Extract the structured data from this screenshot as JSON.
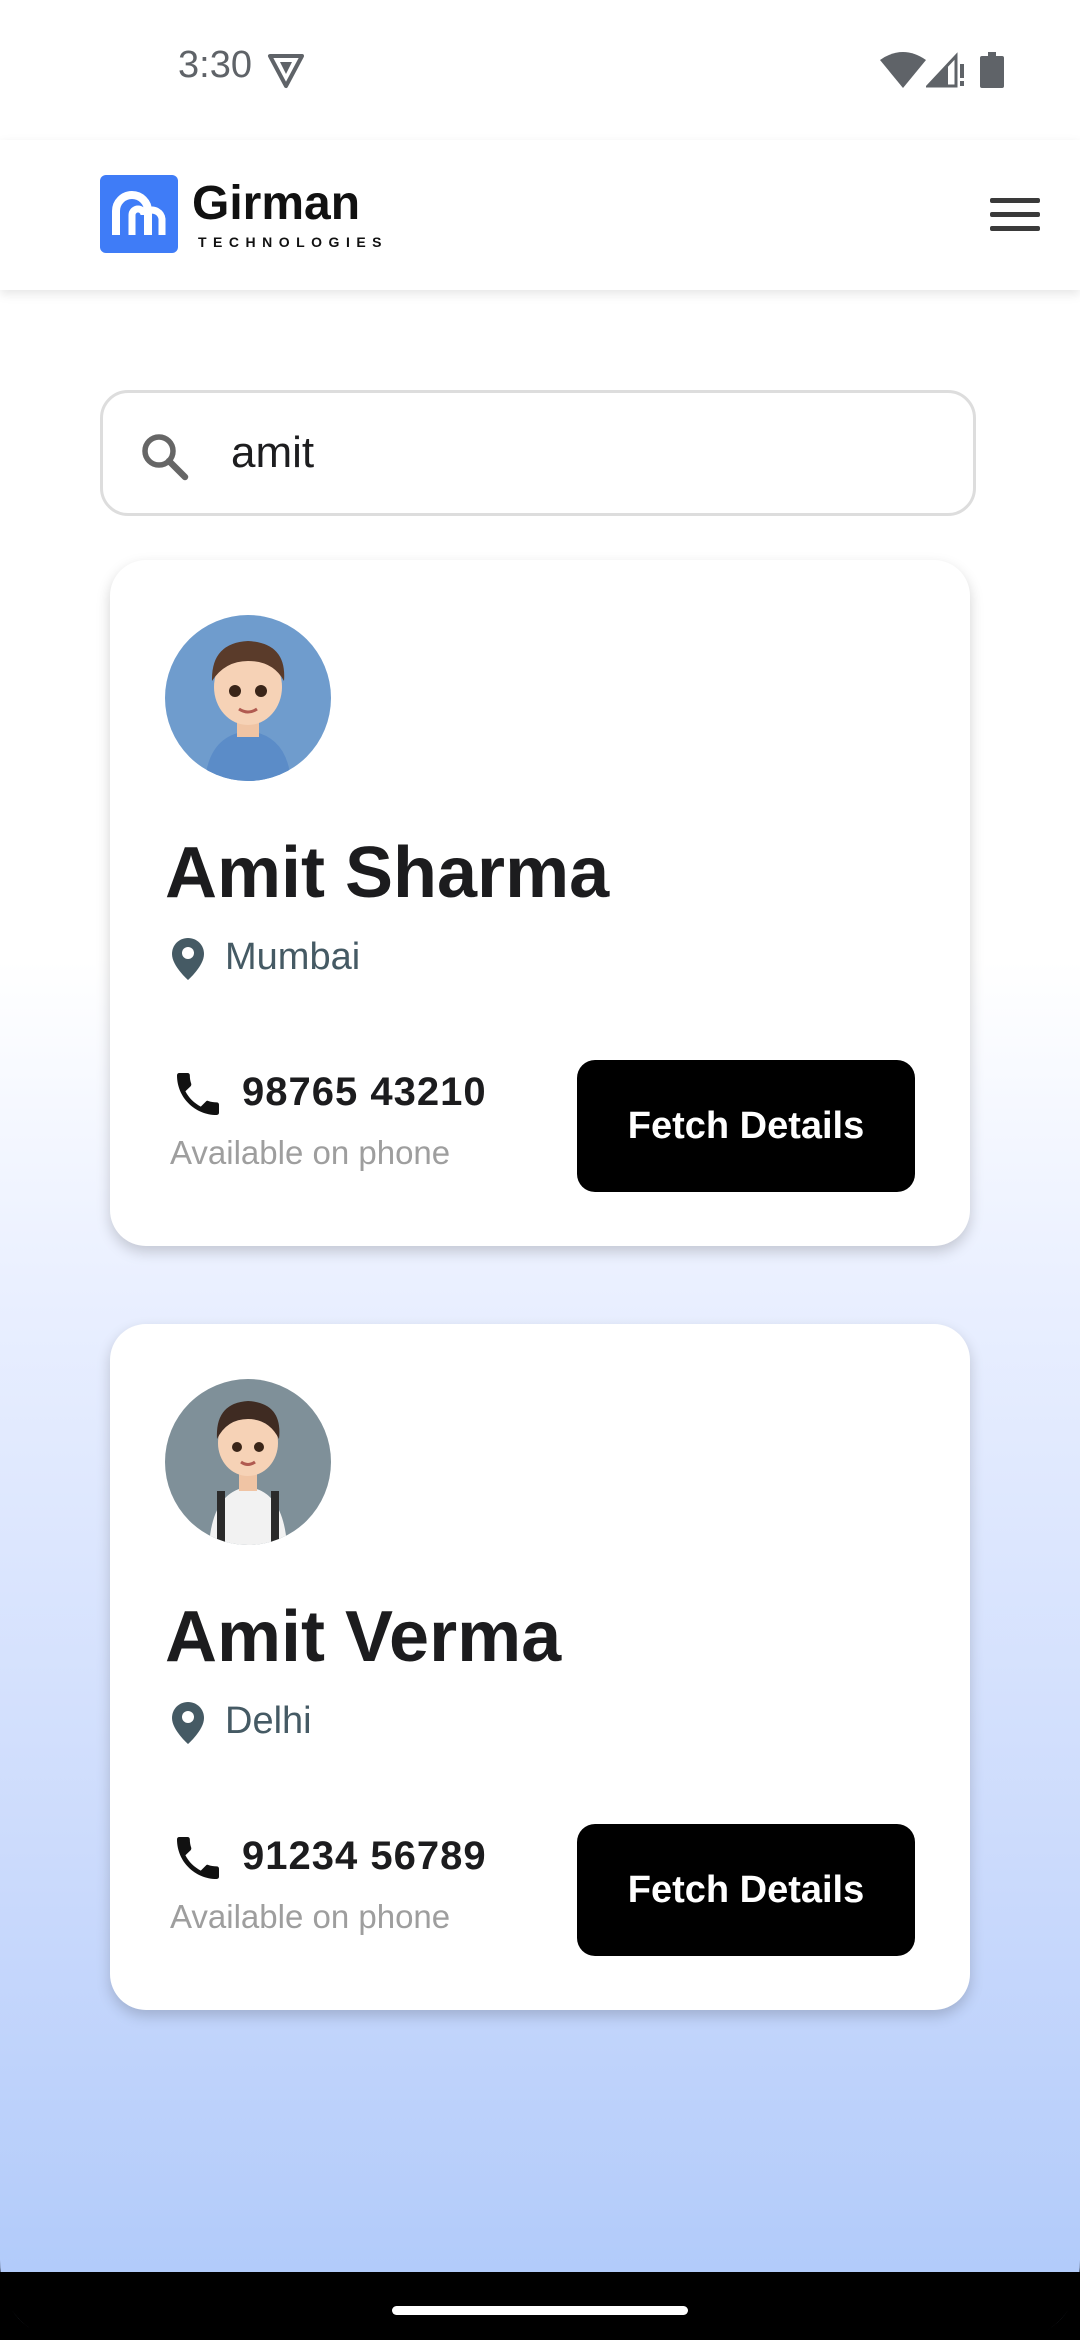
{
  "status_bar": {
    "time": "3:30",
    "icons": [
      "shield-icon",
      "wifi-icon",
      "signal-icon",
      "battery-icon"
    ]
  },
  "header": {
    "brand_name": "Girman",
    "brand_tagline": "TECHNOLOGIES",
    "logo_color": "#3f7cf7",
    "menu_icon": "hamburger-menu-icon"
  },
  "search": {
    "value": "amit",
    "icon": "search-icon"
  },
  "results": [
    {
      "name": "Amit Sharma",
      "city": "Mumbai",
      "phone": "98765 43210",
      "availability": "Available on phone",
      "button_label": "Fetch Details",
      "avatar": "avatar-boy-blue-shirt"
    },
    {
      "name": "Amit Verma",
      "city": "Delhi",
      "phone": "91234 56789",
      "availability": "Available on phone",
      "button_label": "Fetch Details",
      "avatar": "avatar-boy-white-shirt-backpack"
    }
  ],
  "colors": {
    "accent": "#3f7cf7",
    "button_bg": "#000000",
    "city_text": "#455a64",
    "muted_text": "#9e9e9e"
  }
}
